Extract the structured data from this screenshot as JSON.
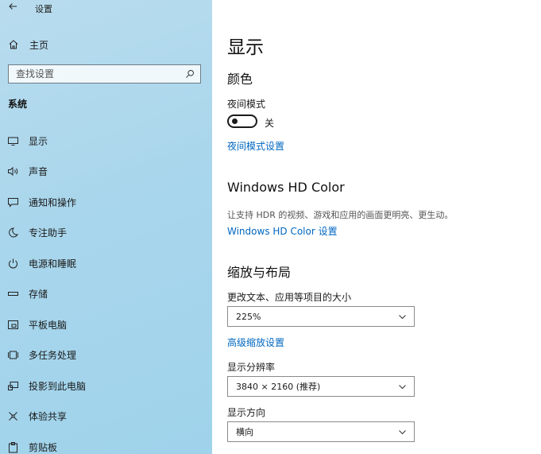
{
  "window": {
    "title": "设置"
  },
  "sidebar": {
    "home_label": "主页",
    "search_placeholder": "查找设置",
    "section_label": "系统",
    "items": [
      {
        "label": "显示",
        "icon": "monitor-icon"
      },
      {
        "label": "声音",
        "icon": "speaker-icon"
      },
      {
        "label": "通知和操作",
        "icon": "notification-icon"
      },
      {
        "label": "专注助手",
        "icon": "moon-icon"
      },
      {
        "label": "电源和睡眠",
        "icon": "power-icon"
      },
      {
        "label": "存储",
        "icon": "storage-icon"
      },
      {
        "label": "平板电脑",
        "icon": "tablet-icon"
      },
      {
        "label": "多任务处理",
        "icon": "multitasking-icon"
      },
      {
        "label": "投影到此电脑",
        "icon": "projecting-icon"
      },
      {
        "label": "体验共享",
        "icon": "shared-experiences-icon"
      },
      {
        "label": "剪贴板",
        "icon": "clipboard-icon"
      }
    ]
  },
  "main": {
    "title": "显示",
    "color": {
      "heading": "颜色",
      "night_light_label": "夜间模式",
      "night_light_state": "关",
      "night_light_on": false,
      "night_light_link": "夜间模式设置"
    },
    "hdr": {
      "heading": "Windows HD Color",
      "description": "让支持 HDR 的视频、游戏和应用的画面更明亮、更生动。",
      "link": "Windows HD Color 设置"
    },
    "scale": {
      "heading": "缩放与布局",
      "scale_label": "更改文本、应用等项目的大小",
      "scale_value": "225%",
      "advanced_link": "高级缩放设置",
      "resolution_label": "显示分辨率",
      "resolution_value": "3840 × 2160 (推荐)",
      "orientation_label": "显示方向",
      "orientation_value": "横向"
    }
  },
  "colors": {
    "sidebar_bg": "#a9d6ec",
    "link": "#0067c0"
  }
}
